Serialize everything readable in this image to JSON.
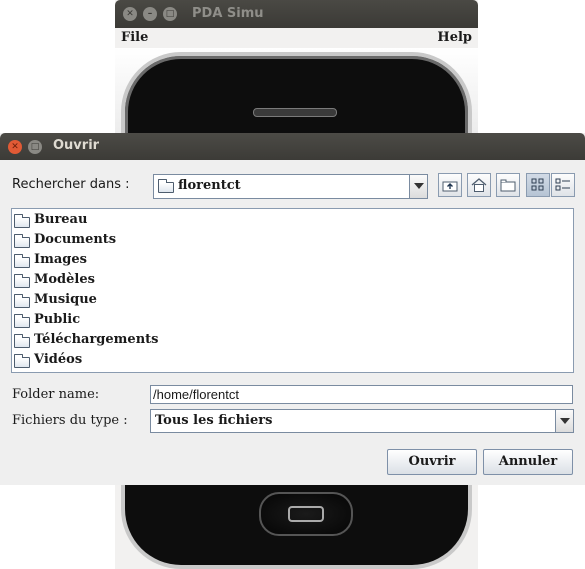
{
  "pda_window": {
    "title": "PDA Simu",
    "menu": {
      "file": "File",
      "help": "Help"
    }
  },
  "dialog": {
    "title": "Ouvrir",
    "look_in_label": "Rechercher dans :",
    "look_in_value": "florentct",
    "toolbar": [
      "up-folder-icon",
      "home-icon",
      "new-folder-icon",
      "list-view-icon",
      "details-view-icon"
    ],
    "files": [
      {
        "name": "Bureau"
      },
      {
        "name": "Documents"
      },
      {
        "name": "Images"
      },
      {
        "name": "Modèles"
      },
      {
        "name": "Musique"
      },
      {
        "name": "Public"
      },
      {
        "name": "Téléchargements"
      },
      {
        "name": "Vidéos"
      }
    ],
    "folder_name_label": "Folder name:",
    "folder_name_value": "/home/florentct",
    "file_type_label": "Fichiers du type :",
    "file_type_value": "Tous les fichiers",
    "open_button": "Ouvrir",
    "cancel_button": "Annuler"
  }
}
